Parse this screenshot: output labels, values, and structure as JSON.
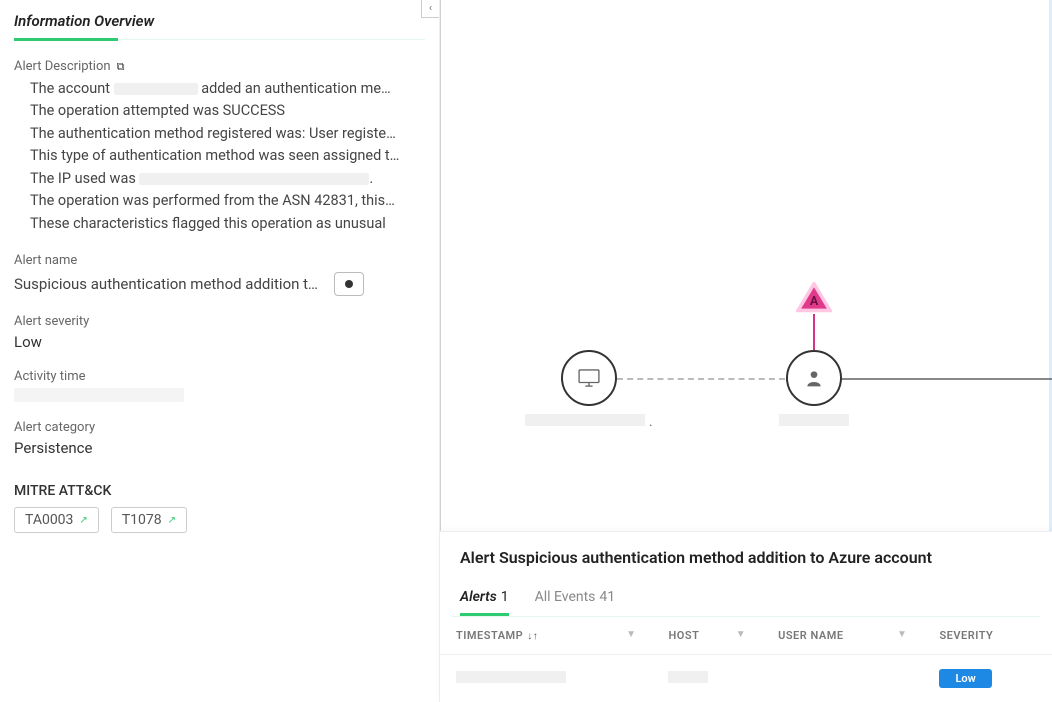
{
  "sidebar": {
    "title": "Information Overview",
    "collapse_glyph": "‹",
    "desc_label": "Alert Description",
    "desc_items": {
      "li1a": "The account ",
      "li1b": " added an authentication me…",
      "li2": "The operation attempted was SUCCESS",
      "li3": "The authentication method registered was: User registe…",
      "li4": "This type of authentication method was seen assigned t…",
      "li5a": "The IP used was ",
      "li5b": ".",
      "li6": "The operation was performed from the ASN 42831, this…",
      "li7": "These characteristics flagged this operation as unusual"
    },
    "alert_name_label": "Alert name",
    "alert_name_value": "Suspicious authentication method addition to …",
    "severity_label": "Alert severity",
    "severity_value": "Low",
    "activity_label": "Activity time",
    "category_label": "Alert category",
    "category_value": "Persistence",
    "mitre_label": "MITRE ATT&CK",
    "mitre_badges": [
      "TA0003",
      "T1078"
    ]
  },
  "graph": {
    "alert_letter": "A"
  },
  "detail": {
    "heading": "Alert Suspicious authentication method addition to Azure account",
    "tabs": {
      "alerts_label": "Alerts",
      "alerts_count": "1",
      "events_label": "All Events",
      "events_count": "41"
    },
    "columns": {
      "timestamp": "TIMESTAMP",
      "host": "HOST",
      "user": "USER NAME",
      "severity": "SEVERITY"
    },
    "rows": [
      {
        "severity": "Low"
      }
    ]
  }
}
